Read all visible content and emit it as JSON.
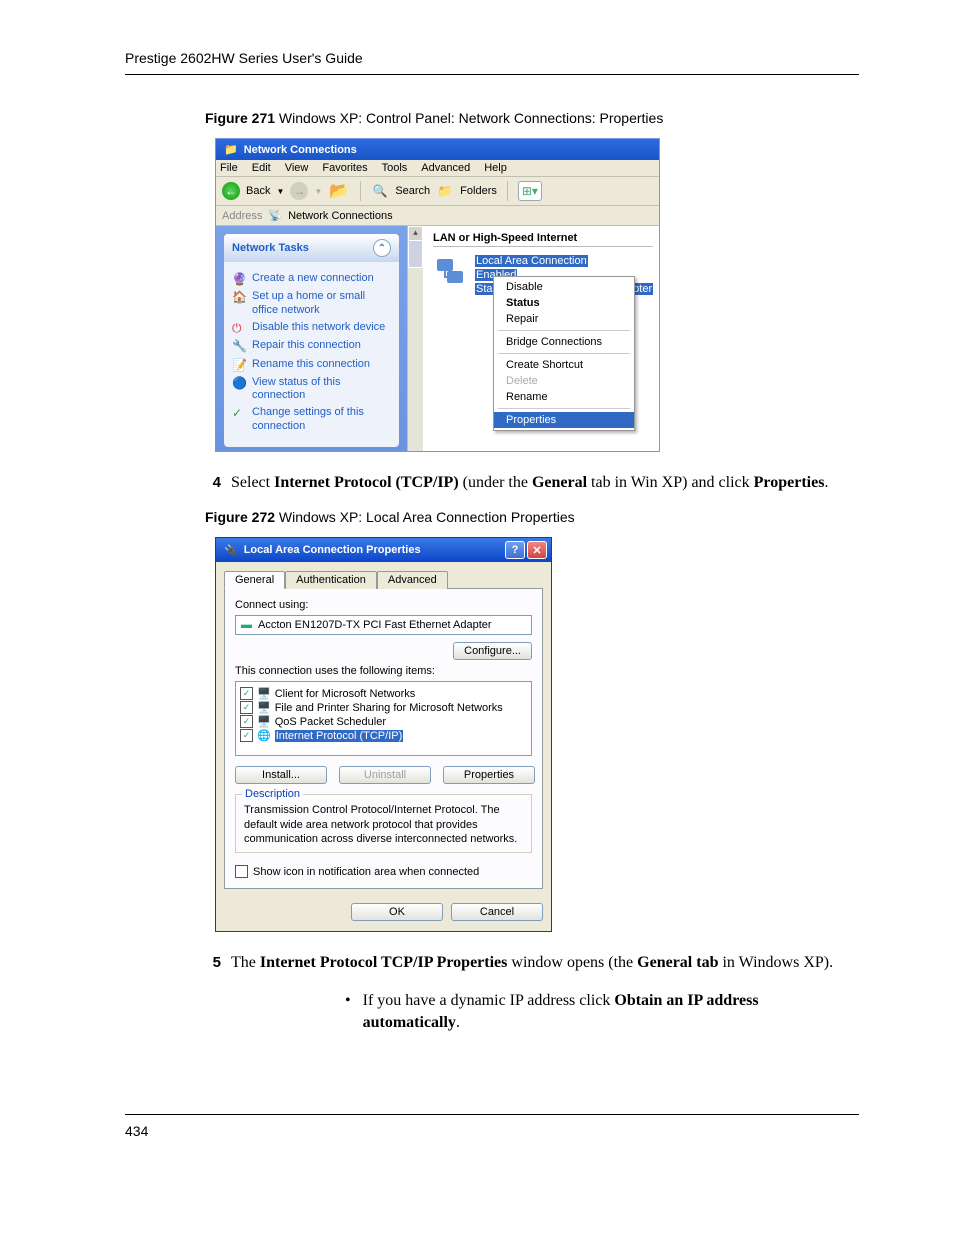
{
  "header": "Prestige 2602HW Series User's Guide",
  "page_number": "434",
  "figure271": {
    "caption_bold": "Figure 271",
    "caption_text": "   Windows XP: Control Panel: Network Connections: Properties",
    "window": {
      "title": "Network Connections",
      "menus": [
        "File",
        "Edit",
        "View",
        "Favorites",
        "Tools",
        "Advanced",
        "Help"
      ],
      "toolbar": {
        "back": "Back",
        "search": "Search",
        "folders": "Folders"
      },
      "address_label": "Address",
      "address_value": "Network Connections",
      "tasks_header": "Network Tasks",
      "tasks": [
        "Create a new connection",
        "Set up a home or small office network",
        "Disable this network device",
        "Repair this connection",
        "Rename this connection",
        "View status of this connection",
        "Change settings of this connection"
      ],
      "group_header": "LAN or High-Speed Internet",
      "conn_name": "Local Area Connection",
      "conn_status": "Enabled",
      "conn_device": "Standard PCI Fast Ethernet Adapter",
      "context_menu": {
        "disable": "Disable",
        "status": "Status",
        "repair": "Repair",
        "bridge": "Bridge Connections",
        "shortcut": "Create Shortcut",
        "delete": "Delete",
        "rename": "Rename",
        "properties": "Properties"
      }
    }
  },
  "step4": {
    "num": "4",
    "pre": "Select ",
    "b1": "Internet Protocol (TCP/IP)",
    "mid1": " (under the ",
    "b2": "General",
    "mid2": " tab in Win XP) and click ",
    "b3": "Properties",
    "end": "."
  },
  "figure272": {
    "caption_bold": "Figure 272",
    "caption_text": "   Windows XP: Local Area Connection Properties",
    "dialog": {
      "title": "Local Area Connection Properties",
      "tabs": [
        "General",
        "Authentication",
        "Advanced"
      ],
      "connect_using_label": "Connect using:",
      "adapter": "Accton EN1207D-TX PCI Fast Ethernet Adapter",
      "configure": "Configure...",
      "uses_items_label": "This connection uses the following items:",
      "items": [
        "Client for Microsoft Networks",
        "File and Printer Sharing for Microsoft Networks",
        "QoS Packet Scheduler",
        "Internet Protocol (TCP/IP)"
      ],
      "install": "Install...",
      "uninstall": "Uninstall",
      "properties": "Properties",
      "desc_legend": "Description",
      "desc_text": "Transmission Control Protocol/Internet Protocol. The default wide area network protocol that provides communication across diverse interconnected networks.",
      "show_icon": "Show icon in notification area when connected",
      "ok": "OK",
      "cancel": "Cancel"
    }
  },
  "step5": {
    "num": "5",
    "pre": "The ",
    "b1": "Internet Protocol TCP/IP Properties",
    "mid1": " window opens (the ",
    "b2": "General tab",
    "mid2": " in Windows XP)."
  },
  "bullet1": {
    "pre": "If you have a dynamic IP address click ",
    "b1": "Obtain an IP address automatically",
    "end": "."
  }
}
